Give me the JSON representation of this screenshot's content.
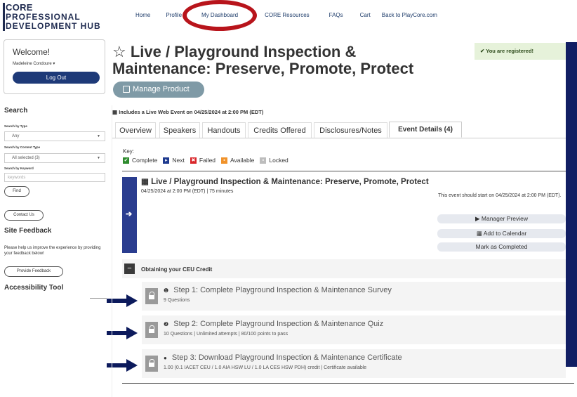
{
  "logo": {
    "line1": "CORE",
    "line2": "PROFESSIONAL",
    "line3": "DEVELOPMENT HUB"
  },
  "topnav": [
    "Home",
    "Profile",
    "My Dashboard",
    "CORE Resources",
    "FAQs",
    "Cart",
    "Back to PlayCore.com"
  ],
  "sidebar": {
    "welcome": "Welcome!",
    "user": "Madeleine Condoure ▾",
    "logout": "Log Out",
    "search_heading": "Search",
    "search_by_type_label": "Search by Type",
    "search_by_type_value": "Any",
    "search_by_content_label": "Search by Content Type",
    "search_by_content_value": "All selected (3)",
    "search_by_keyword_label": "Search by Keyword",
    "keyword_placeholder": "keywords",
    "find": "Find",
    "contact": "Contact Us",
    "feedback_heading": "Site Feedback",
    "feedback_text": "Please help us improve the experience by providing your feedback below!",
    "provide_feedback": "Provide Feedback",
    "accessibility": "Accessibility Tool"
  },
  "main": {
    "title_line1": "Live / Playground Inspection &",
    "title_line2": "Maintenance: Preserve, Promote, Protect",
    "manage": "Manage Product",
    "registered": "You are registered!",
    "live_line": "Includes a Live Web Event on 04/25/2024 at 2:00 PM (EDT)",
    "tabs": [
      "Overview",
      "Speakers",
      "Handouts",
      "Credits Offered",
      "Disclosures/Notes",
      "Event Details (4)"
    ],
    "key_label": "Key:",
    "key_items": [
      {
        "label": "Complete",
        "color": "#2e8b2e",
        "glyph": "✔"
      },
      {
        "label": "Next",
        "color": "#1e3a8f",
        "glyph": "▸"
      },
      {
        "label": "Failed",
        "color": "#d9262a",
        "glyph": "✖"
      },
      {
        "label": "Available",
        "color": "#f0922a",
        "glyph": "▪"
      },
      {
        "label": "Locked",
        "color": "#bdbdbd",
        "glyph": "▪"
      }
    ],
    "event": {
      "title": "Live / Playground Inspection & Maintenance: Preserve, Promote, Protect",
      "sub": "04/25/2024 at 2:00 PM (EDT)  |  75 minutes",
      "note": "This event should start on 04/25/2024 at 2:00 PM (EDT).",
      "btn_preview": "Manager Preview",
      "btn_calendar": "Add to Calendar",
      "btn_mark": "Mark as Completed"
    },
    "ceu_title": "Obtaining your CEU Credit",
    "steps": [
      {
        "title": "Step 1: Complete Playground Inspection & Maintenance Survey",
        "sub": "9 Questions",
        "dot": "❶"
      },
      {
        "title": "Step 2: Complete Playground Inspection & Maintenance Quiz",
        "sub": "10 Questions  |  Unlimited attempts  |  80/100 points to pass",
        "dot": "❷"
      },
      {
        "title": "Step 3: Download Playground Inspection & Maintenance Certificate",
        "sub": "1.00 (0.1 IACET CEU / 1.0 AIA HSW LU / 1.0 LA CES HSW PDH) credit  |  Certificate available",
        "dot": "●"
      }
    ]
  },
  "colors": {
    "navy": "#1e2a4f",
    "rail": "#111e63",
    "annotation_red": "#b8141b",
    "arrow": "#0c1a5c"
  }
}
